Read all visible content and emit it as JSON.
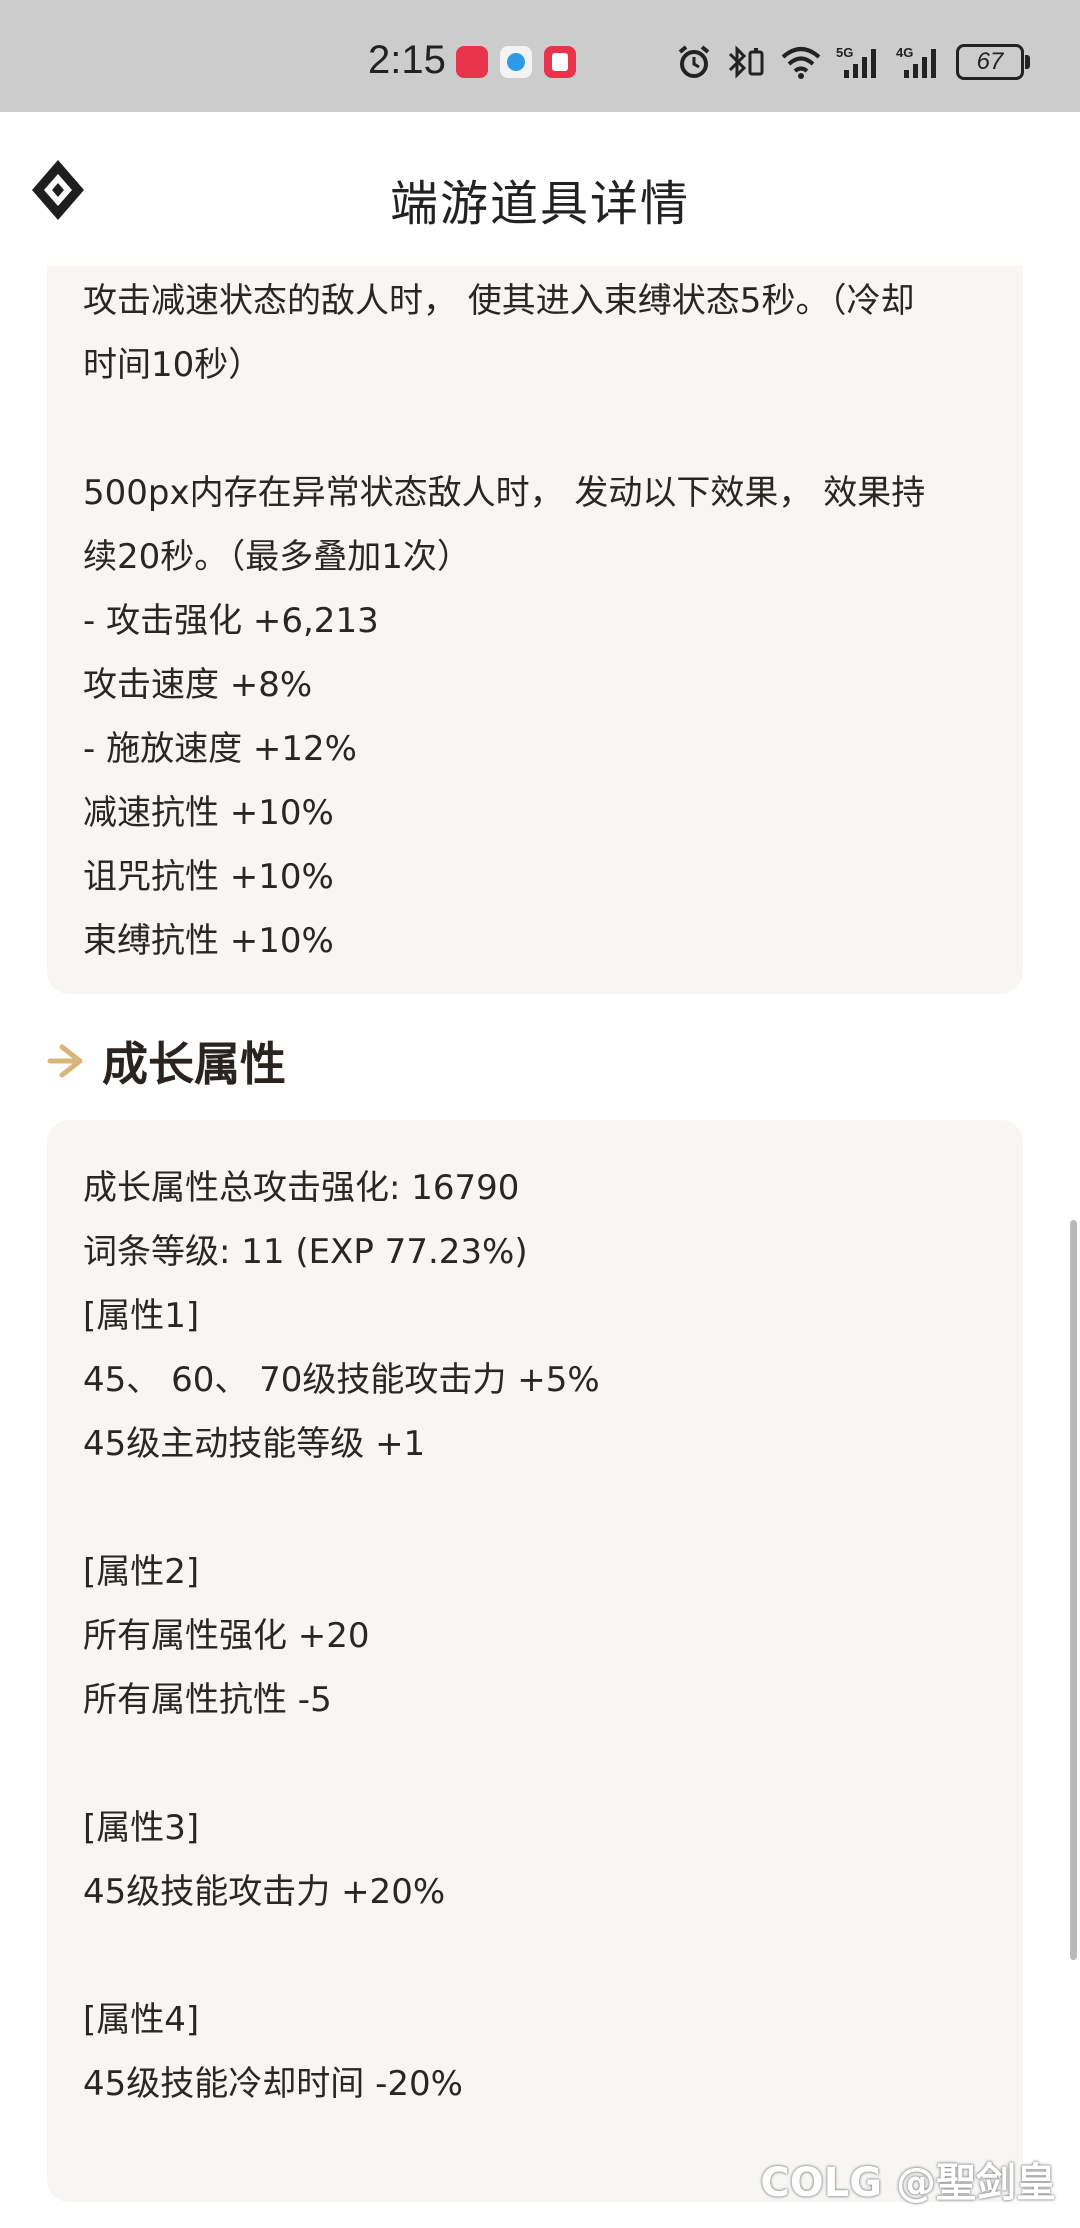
{
  "status_bar": {
    "time": "2:15",
    "battery": "67",
    "network_labels": [
      "5G",
      "4G"
    ]
  },
  "header": {
    "title": "端游道具详情"
  },
  "effects_card": {
    "lines": [
      "攻击减速状态的敌人时， 使其进入束缚状态5秒。（冷却",
      "时间10秒）",
      "",
      "500px内存在异常状态敌人时， 发动以下效果， 效果持",
      "续20秒。（最多叠加1次）",
      "- 攻击强化 +6,213",
      "攻击速度 +8%",
      "- 施放速度 +12%",
      "减速抗性 +10%",
      "诅咒抗性 +10%",
      "束缚抗性 +10%"
    ]
  },
  "growth_section": {
    "title": "成长属性",
    "lines": [
      "成长属性总攻击强化: 16790",
      "词条等级: 11 (EXP 77.23%)",
      "[属性1]",
      "45、 60、 70级技能攻击力 +5%",
      "45级主动技能等级 +1",
      "",
      "[属性2]",
      "所有属性强化 +20",
      "所有属性抗性 -5",
      "",
      "[属性3]",
      "45级技能攻击力 +20%",
      "",
      "[属性4]",
      "45级技能冷却时间 -20%"
    ]
  },
  "watermark": "COLG @聖剑皇",
  "colors": {
    "status_bar_bg": "#cccccc",
    "card_bg": "#f7f6f4",
    "accent_arrow": "#d9b57a",
    "text": "#2a2622"
  }
}
